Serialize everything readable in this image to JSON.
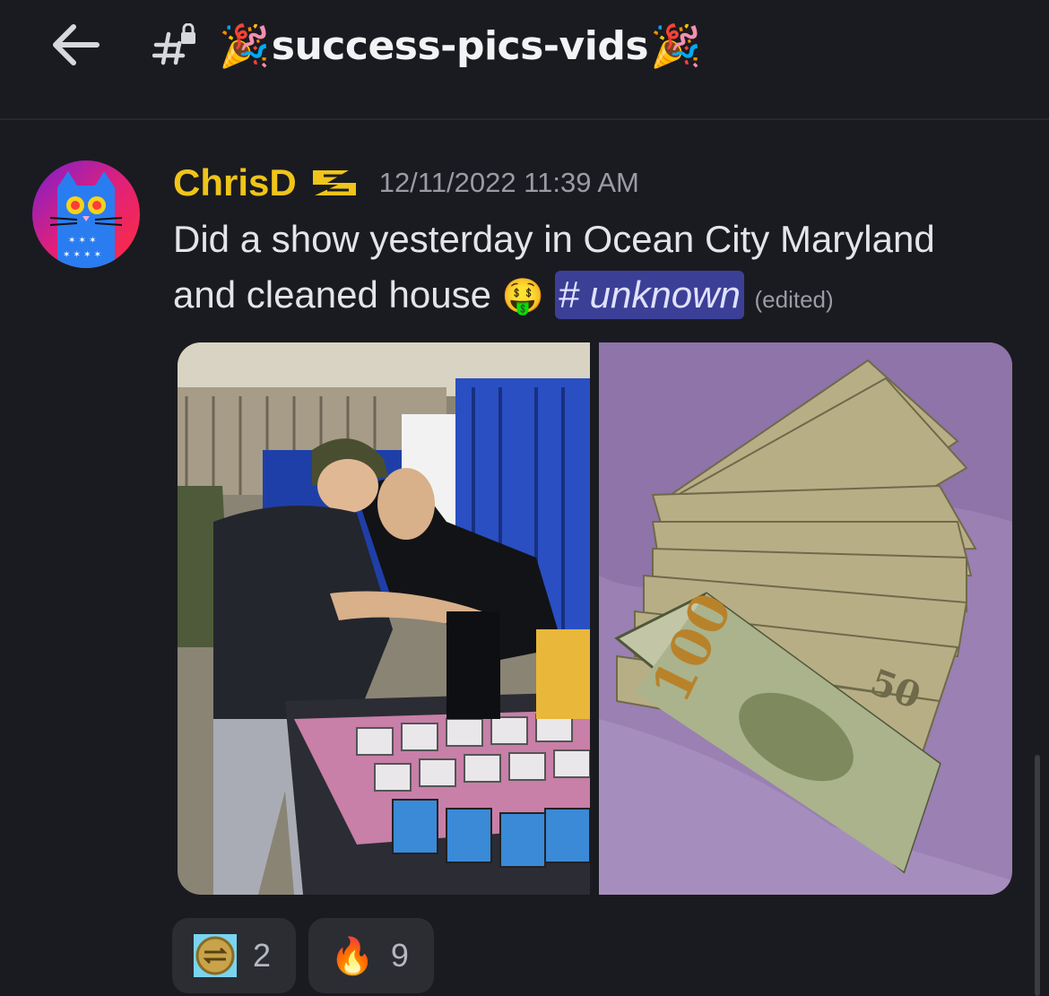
{
  "header": {
    "channel_name": "success-pics-vids",
    "emoji_left": "🎉",
    "emoji_right": "🎉"
  },
  "message": {
    "author": "ChrisD",
    "author_color": "#f0c419",
    "timestamp": "12/11/2022 11:39 AM",
    "text_line1": "Did a show yesterday in Ocean City Maryland",
    "text_line2": "and cleaned house",
    "text_emoji": "🤑",
    "mention": "# unknown",
    "edited": "(edited)"
  },
  "attachments": [
    {
      "icon": "photo-convention-booth"
    },
    {
      "icon": "photo-cash-stack"
    }
  ],
  "reactions": [
    {
      "emoji": "gold-coin-emoji",
      "count": "2"
    },
    {
      "emoji": "🔥",
      "count": "9"
    }
  ],
  "colors": {
    "background": "#1a1b20",
    "mention_bg": "#3c3f96",
    "reaction_bg": "#2b2d33"
  }
}
